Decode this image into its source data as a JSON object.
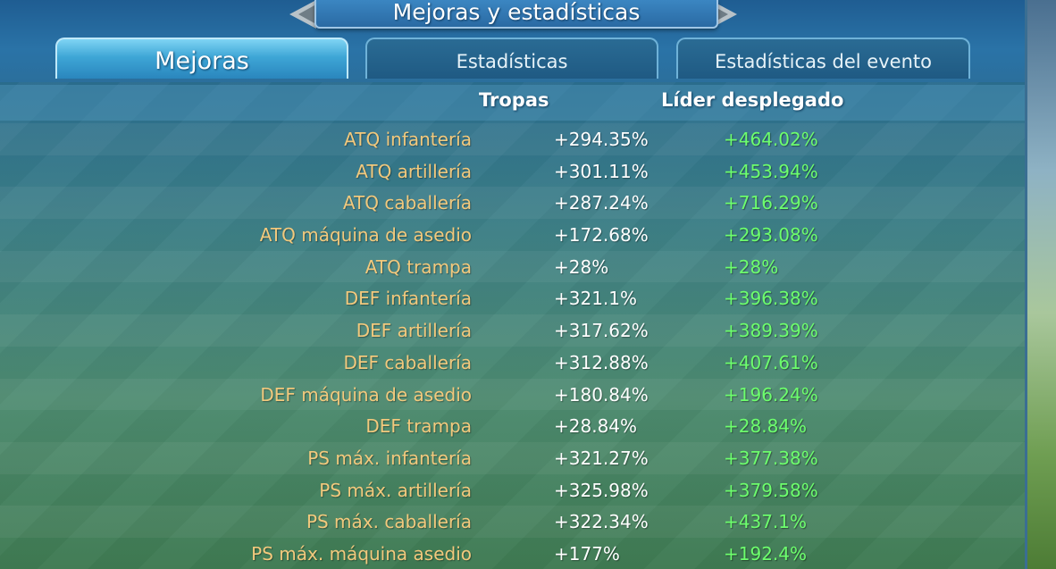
{
  "window": {
    "title": "Mejoras y estadísticas"
  },
  "tabs": [
    {
      "label": "Mejoras",
      "active": true
    },
    {
      "label": "Estadísticas",
      "active": false
    },
    {
      "label": "Estadísticas del evento",
      "active": false
    }
  ],
  "table": {
    "headers": {
      "troops": "Tropas",
      "leader": "Líder desplegado"
    },
    "rows": [
      {
        "name": "ATQ infantería",
        "troops": "+294.35%",
        "leader": "+464.02%"
      },
      {
        "name": "ATQ artillería",
        "troops": "+301.11%",
        "leader": "+453.94%"
      },
      {
        "name": "ATQ caballería",
        "troops": "+287.24%",
        "leader": "+716.29%"
      },
      {
        "name": "ATQ máquina de asedio",
        "troops": "+172.68%",
        "leader": "+293.08%"
      },
      {
        "name": "ATQ trampa",
        "troops": "+28%",
        "leader": "+28%"
      },
      {
        "name": "DEF infantería",
        "troops": "+321.1%",
        "leader": "+396.38%"
      },
      {
        "name": "DEF artillería",
        "troops": "+317.62%",
        "leader": "+389.39%"
      },
      {
        "name": "DEF caballería",
        "troops": "+312.88%",
        "leader": "+407.61%"
      },
      {
        "name": "DEF máquina de asedio",
        "troops": "+180.84%",
        "leader": "+196.24%"
      },
      {
        "name": "DEF trampa",
        "troops": "+28.84%",
        "leader": "+28.84%"
      },
      {
        "name": "PS máx. infantería",
        "troops": "+321.27%",
        "leader": "+377.38%"
      },
      {
        "name": "PS máx. artillería",
        "troops": "+325.98%",
        "leader": "+379.58%"
      },
      {
        "name": "PS máx. caballería",
        "troops": "+322.34%",
        "leader": "+437.1%"
      },
      {
        "name": "PS máx. máquina asedio",
        "troops": "+177%",
        "leader": "+192.4%"
      }
    ]
  },
  "colors": {
    "stat_name": "#f2c97d",
    "troops_value": "#ffffff",
    "leader_value": "#6dff6d",
    "active_tab": "#3ea6d6"
  }
}
